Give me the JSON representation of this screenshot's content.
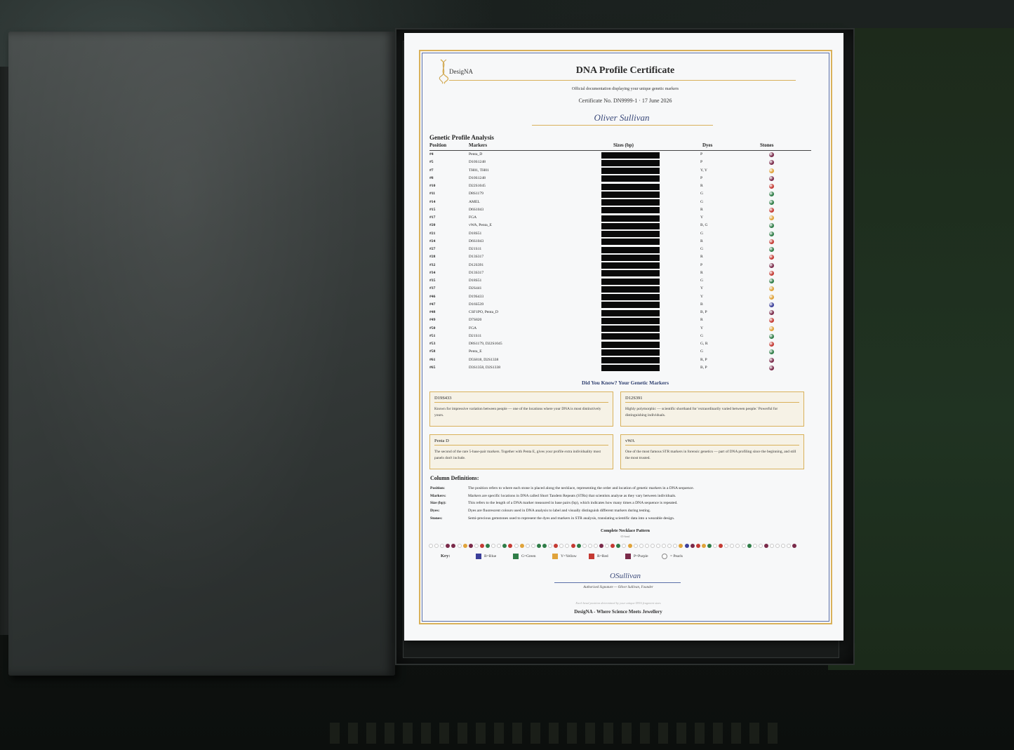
{
  "colors": {
    "gold": "#d9b15a",
    "navy": "#2c3d6e",
    "purple": "#7a2a4a",
    "red": "#c43a33",
    "green": "#2f7d47",
    "yellow": "#e0a33a",
    "blue": "#3b3f9a",
    "pearl": "#ffffff"
  },
  "certificate": {
    "logo_text": "DesigNA",
    "title": "DNA Profile Certificate",
    "subtitle": "Official documentation displaying your unique genetic markers",
    "cert_no": "Certificate No. DN9999-1   ·   17 June 2026",
    "name": "Oliver Sullivan",
    "section_title": "Genetic Profile Analysis",
    "headers": {
      "position": "Position",
      "markers": "Markers",
      "sizes": "Sizes (bp)",
      "dyes": "Dyes",
      "stones": "Stones"
    },
    "rows": [
      {
        "pos": "#4",
        "marker": "Penta_D",
        "dye": "P",
        "stone": "purple"
      },
      {
        "pos": "#5",
        "marker": "D10S1248",
        "dye": "P",
        "stone": "purple"
      },
      {
        "pos": "#7",
        "marker": "TH01, TH01",
        "dye": "Y, Y",
        "stone": "yellow"
      },
      {
        "pos": "#8",
        "marker": "D10S1248",
        "dye": "P",
        "stone": "purple"
      },
      {
        "pos": "#10",
        "marker": "D22S1045",
        "dye": "R",
        "stone": "red"
      },
      {
        "pos": "#11",
        "marker": "D8S1179",
        "dye": "G",
        "stone": "green"
      },
      {
        "pos": "#14",
        "marker": "AMEL",
        "dye": "G",
        "stone": "green"
      },
      {
        "pos": "#15",
        "marker": "D6S1043",
        "dye": "R",
        "stone": "red"
      },
      {
        "pos": "#17",
        "marker": "FGA",
        "dye": "Y",
        "stone": "yellow"
      },
      {
        "pos": "#20",
        "marker": "vWA, Penta_E",
        "dye": "B, G",
        "stone": "green"
      },
      {
        "pos": "#21",
        "marker": "D18S51",
        "dye": "G",
        "stone": "green"
      },
      {
        "pos": "#24",
        "marker": "D6S1043",
        "dye": "R",
        "stone": "red"
      },
      {
        "pos": "#27",
        "marker": "D21S11",
        "dye": "G",
        "stone": "green"
      },
      {
        "pos": "#28",
        "marker": "D13S317",
        "dye": "R",
        "stone": "red"
      },
      {
        "pos": "#32",
        "marker": "D12S391",
        "dye": "P",
        "stone": "purple"
      },
      {
        "pos": "#34",
        "marker": "D13S317",
        "dye": "R",
        "stone": "red"
      },
      {
        "pos": "#35",
        "marker": "D18S51",
        "dye": "G",
        "stone": "green"
      },
      {
        "pos": "#37",
        "marker": "D2S441",
        "dye": "Y",
        "stone": "yellow"
      },
      {
        "pos": "#46",
        "marker": "D19S433",
        "dye": "Y",
        "stone": "yellow"
      },
      {
        "pos": "#47",
        "marker": "D16S539",
        "dye": "B",
        "stone": "blue"
      },
      {
        "pos": "#48",
        "marker": "CSF1PO, Penta_D",
        "dye": "B, P",
        "stone": "purple"
      },
      {
        "pos": "#49",
        "marker": "D7S820",
        "dye": "R",
        "stone": "red"
      },
      {
        "pos": "#50",
        "marker": "FGA",
        "dye": "Y",
        "stone": "yellow"
      },
      {
        "pos": "#51",
        "marker": "D21S11",
        "dye": "G",
        "stone": "green"
      },
      {
        "pos": "#53",
        "marker": "D8S1179, D22S1045",
        "dye": "G, R",
        "stone": "red"
      },
      {
        "pos": "#58",
        "marker": "Penta_E",
        "dye": "G",
        "stone": "green"
      },
      {
        "pos": "#61",
        "marker": "D5S818, D2S1338",
        "dye": "R, P",
        "stone": "purple"
      },
      {
        "pos": "#65",
        "marker": "D3S1358, D2S1338",
        "dye": "B, P",
        "stone": "purple"
      }
    ],
    "did_you_know_title": "Did You Know? Your Genetic Markers",
    "cards": [
      {
        "title": "D19S433",
        "body": "Known for impressive variation between people — one of the locations where your DNA is most distinctively yours."
      },
      {
        "title": "D12S391",
        "body": "Highly polymorphic — scientific shorthand for 'extraordinarily varied between people.' Powerful for distinguishing individuals."
      },
      {
        "title": "Penta D",
        "body": "The second of the rare 5-base-pair markers. Together with Penta E, gives your profile extra individuality most panels don't include."
      },
      {
        "title": "vWA",
        "body": "One of the most famous STR markers in forensic genetics — part of DNA profiling since the beginning, and still the most trusted."
      }
    ],
    "column_definitions_title": "Column Definitions:",
    "column_definitions": [
      {
        "k": "Position:",
        "v": "The position refers to where each stone is placed along the necklace, representing the order and location of genetic markers in a DNA sequence."
      },
      {
        "k": "Markers:",
        "v": "Markers are specific locations in DNA called Short Tandem Repeats (STRs) that scientists analyse as they vary between individuals."
      },
      {
        "k": "Size (bp):",
        "v": "This refers to the length of a DNA marker measured in base pairs (bp), which indicates how many times a DNA sequence is repeated."
      },
      {
        "k": "Dyes:",
        "v": "Dyes are fluorescent colours used in DNA analysis to label and visually distinguish different markers during testing."
      },
      {
        "k": "Stones:",
        "v": "Semi-precious gemstones used to represent the dyes and markers in STR analysis, translating scientific data into a wearable design."
      }
    ],
    "necklace_title": "Complete Necklace Pattern",
    "necklace_sub": "65-bead",
    "necklace_beads": [
      "pearl",
      "pearl",
      "pearl",
      "purple",
      "purple",
      "pearl",
      "yellow",
      "purple",
      "pearl",
      "red",
      "green",
      "pearl",
      "pearl",
      "green",
      "red",
      "pearl",
      "yellow",
      "pearl",
      "pearl",
      "green",
      "green",
      "pearl",
      "red",
      "pearl",
      "pearl",
      "red",
      "green",
      "pearl",
      "pearl",
      "pearl",
      "purple",
      "pearl",
      "red",
      "green",
      "pearl",
      "yellow",
      "pearl",
      "pearl",
      "pearl",
      "pearl",
      "pearl",
      "pearl",
      "pearl",
      "pearl",
      "yellow",
      "blue",
      "purple",
      "red",
      "yellow",
      "green",
      "pearl",
      "red",
      "pearl",
      "pearl",
      "pearl",
      "pearl",
      "green",
      "pearl",
      "pearl",
      "purple",
      "pearl",
      "pearl",
      "pearl",
      "pearl",
      "purple"
    ],
    "key_label": "Key:",
    "key": [
      {
        "color": "blue",
        "label": "B=Blue"
      },
      {
        "color": "green",
        "label": "G=Green"
      },
      {
        "color": "yellow",
        "label": "Y=Yellow"
      },
      {
        "color": "red",
        "label": "R=Red"
      },
      {
        "color": "purple",
        "label": "P=Purple"
      },
      {
        "color": "pearl",
        "label": "= Pearls"
      }
    ],
    "signature": "OSullivan",
    "signature_caption": "Authorised Signature — Oliver Sullivan, Founder",
    "foot_note": "Each bead position determined by your unique DNA fragment sizes",
    "footer": "DesigNA - Where Science Meets Jewellery"
  }
}
